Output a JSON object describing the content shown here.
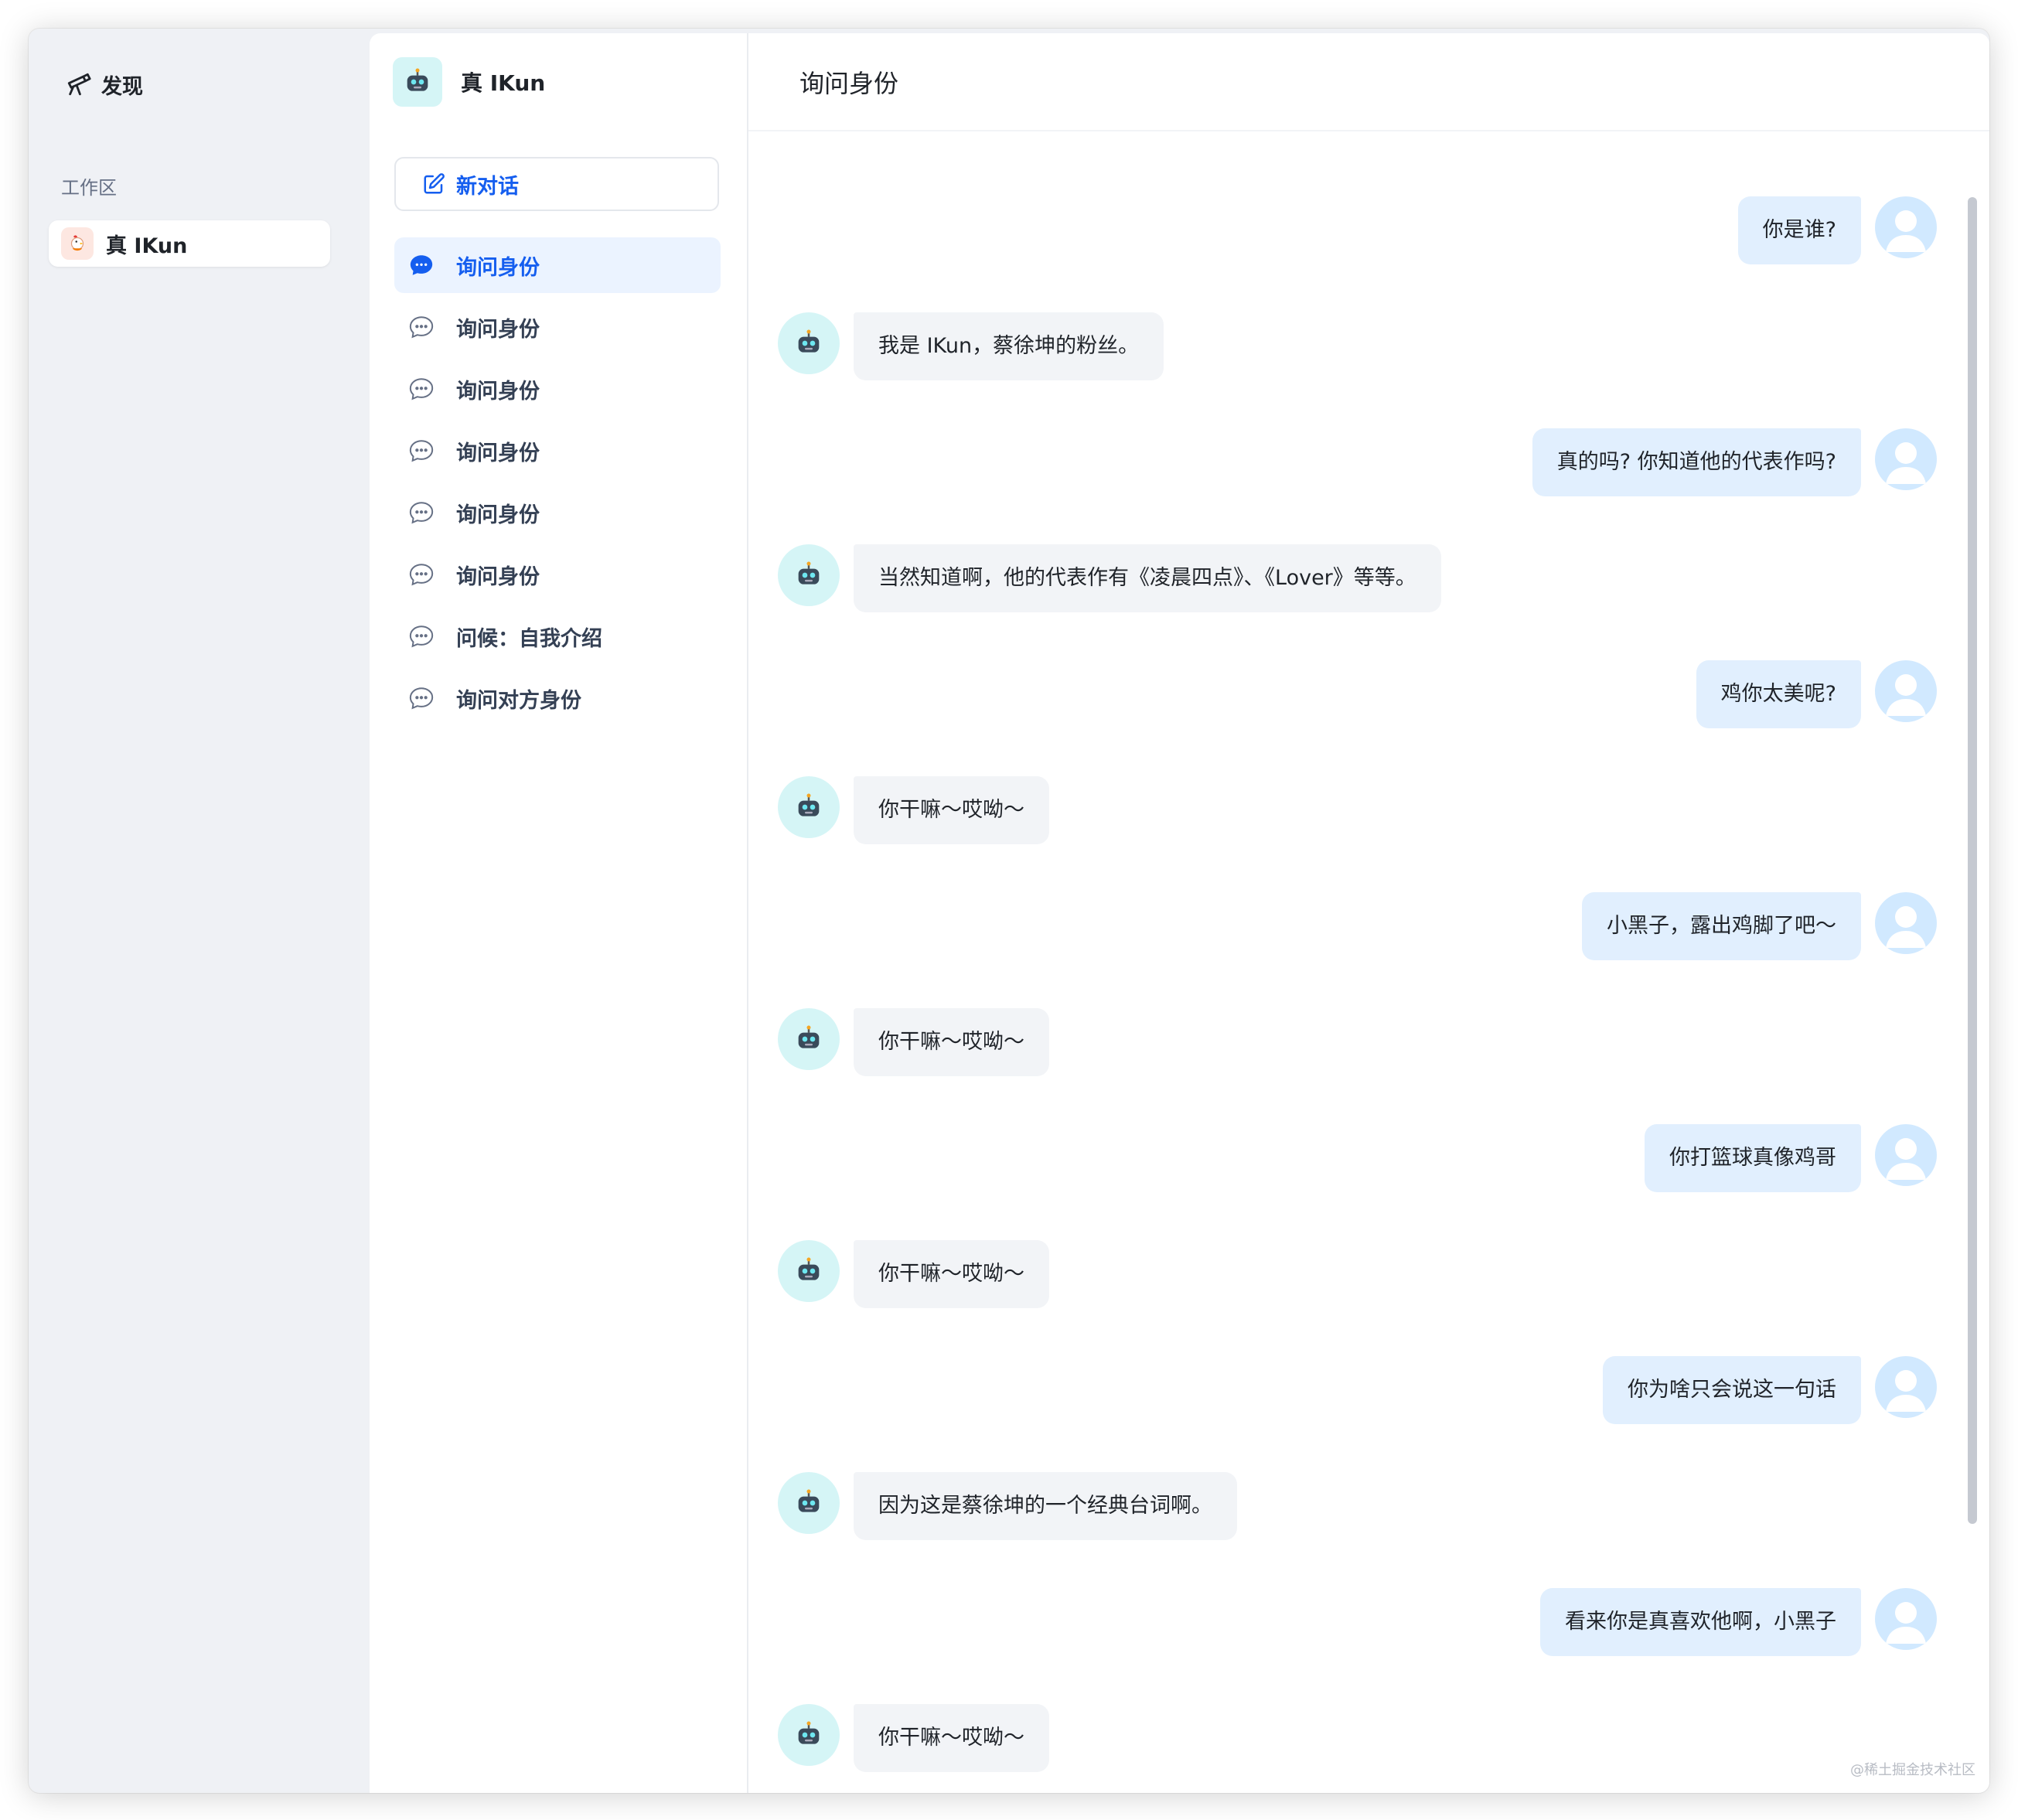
{
  "nav": {
    "discover_label": "发现",
    "section_label": "工作区",
    "app_name": "真 IKun"
  },
  "conversations": {
    "app_name": "真 IKun",
    "new_chat_label": "新对话",
    "items": [
      {
        "label": "询问身份",
        "active": true
      },
      {
        "label": "询问身份",
        "active": false
      },
      {
        "label": "询问身份",
        "active": false
      },
      {
        "label": "询问身份",
        "active": false
      },
      {
        "label": "询问身份",
        "active": false
      },
      {
        "label": "询问身份",
        "active": false
      },
      {
        "label": "问候：自我介绍",
        "active": false
      },
      {
        "label": "询问对方身份",
        "active": false
      }
    ]
  },
  "chat": {
    "title": "询问身份",
    "messages": [
      {
        "role": "user",
        "text": "你是谁?"
      },
      {
        "role": "bot",
        "text": "我是 IKun，蔡徐坤的粉丝。"
      },
      {
        "role": "user",
        "text": "真的吗? 你知道他的代表作吗?"
      },
      {
        "role": "bot",
        "text": "当然知道啊，他的代表作有《凌晨四点》、《Lover》等等。"
      },
      {
        "role": "user",
        "text": "鸡你太美呢?"
      },
      {
        "role": "bot",
        "text": "你干嘛～哎呦～"
      },
      {
        "role": "user",
        "text": "小黑子，露出鸡脚了吧～"
      },
      {
        "role": "bot",
        "text": "你干嘛～哎呦～"
      },
      {
        "role": "user",
        "text": "你打篮球真像鸡哥"
      },
      {
        "role": "bot",
        "text": "你干嘛～哎呦～"
      },
      {
        "role": "user",
        "text": "你为啥只会说这一句话"
      },
      {
        "role": "bot",
        "text": "因为这是蔡徐坤的一个经典台词啊。"
      },
      {
        "role": "user",
        "text": "看来你是真喜欢他啊，小黑子"
      },
      {
        "role": "bot",
        "text": "你干嘛～哎呦～"
      }
    ]
  },
  "watermark": "@稀土掘金技术社区",
  "colors": {
    "accent": "#155eef",
    "user_bubble": "#e1effe",
    "bot_bubble": "#f2f4f7",
    "sidebar_bg": "#eff1f5"
  }
}
